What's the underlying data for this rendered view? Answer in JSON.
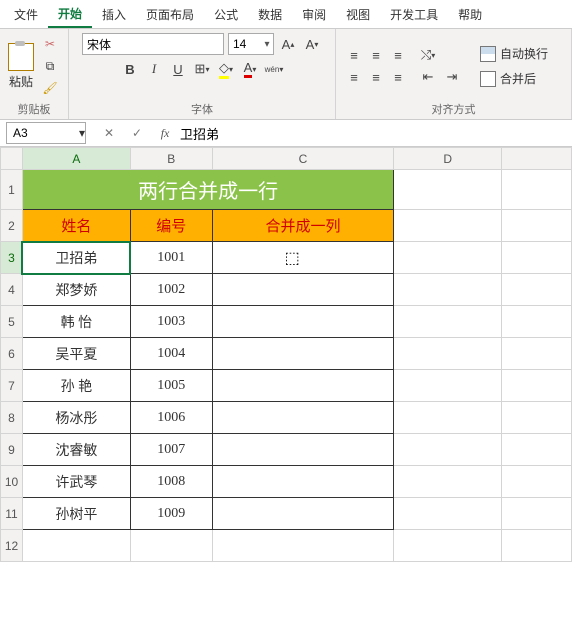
{
  "tabs": {
    "file": "文件",
    "home": "开始",
    "insert": "插入",
    "layout": "页面布局",
    "formula": "公式",
    "data": "数据",
    "review": "审阅",
    "view": "视图",
    "dev": "开发工具",
    "help": "帮助"
  },
  "clipboard": {
    "paste": "粘贴",
    "label": "剪贴板"
  },
  "font": {
    "name": "宋体",
    "size": "14",
    "bold": "B",
    "italic": "I",
    "underline": "U",
    "grow": "A",
    "shrink": "A",
    "label": "字体"
  },
  "align": {
    "wrap": "自动换行",
    "merge": "合并后",
    "label": "对齐方式"
  },
  "namebox": {
    "ref": "A3"
  },
  "formula": {
    "cancel": "✕",
    "confirm": "✓",
    "fx": "fx",
    "value": "卫招弟"
  },
  "cols": {
    "a": "A",
    "b": "B",
    "c": "C",
    "d": "D"
  },
  "rows": {
    "r1": "1",
    "r2": "2",
    "r3": "3",
    "r4": "4",
    "r5": "5",
    "r6": "6",
    "r7": "7",
    "r8": "8",
    "r9": "9",
    "r10": "10",
    "r11": "11",
    "r12": "12"
  },
  "sheet": {
    "title": "两行合并成一行",
    "hdr_name": "姓名",
    "hdr_id": "编号",
    "hdr_merge": "合并成一列",
    "d": [
      {
        "n": "卫招弟",
        "i": "1001"
      },
      {
        "n": "郑梦娇",
        "i": "1002"
      },
      {
        "n": "韩   怡",
        "i": "1003"
      },
      {
        "n": "吴平夏",
        "i": "1004"
      },
      {
        "n": "孙   艳",
        "i": "1005"
      },
      {
        "n": "杨冰彤",
        "i": "1006"
      },
      {
        "n": "沈睿敏",
        "i": "1007"
      },
      {
        "n": "许武琴",
        "i": "1008"
      },
      {
        "n": "孙树平",
        "i": "1009"
      }
    ]
  }
}
